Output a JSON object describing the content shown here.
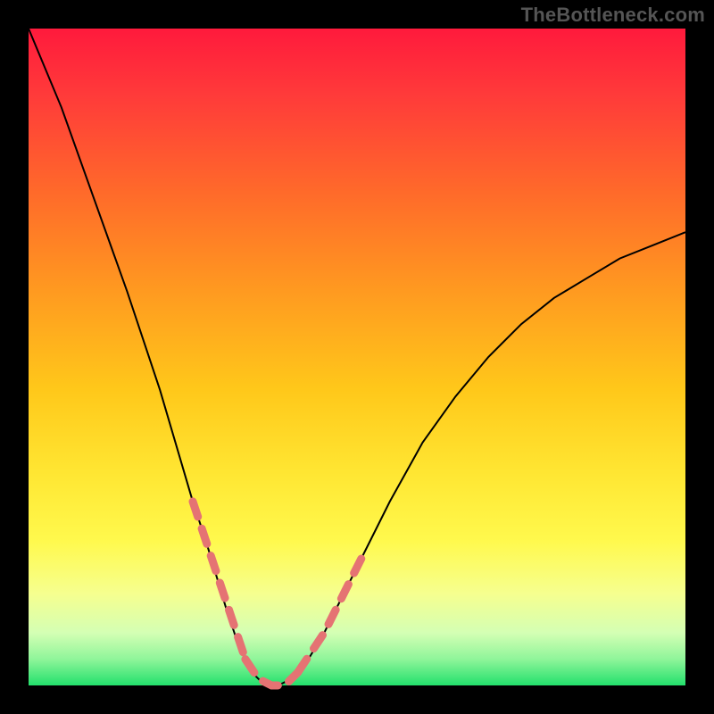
{
  "watermark": "TheBottleneck.com",
  "chart_data": {
    "type": "line",
    "title": "",
    "xlabel": "",
    "ylabel": "",
    "xlim": [
      0,
      100
    ],
    "ylim": [
      0,
      100
    ],
    "grid": false,
    "legend": false,
    "series": [
      {
        "name": "bottleneck-curve",
        "x": [
          0,
          5,
          10,
          15,
          20,
          25,
          27,
          30,
          32,
          34,
          36,
          38,
          40,
          42,
          45,
          50,
          55,
          60,
          65,
          70,
          75,
          80,
          85,
          90,
          95,
          100
        ],
        "y": [
          100,
          88,
          74,
          60,
          45,
          28,
          22,
          12,
          6,
          2,
          0,
          0,
          1,
          3,
          8,
          18,
          28,
          37,
          44,
          50,
          55,
          59,
          62,
          65,
          67,
          69
        ]
      }
    ],
    "highlight_segments": [
      {
        "name": "left-descent-dashes",
        "x": [
          25,
          27,
          29,
          31,
          33
        ],
        "y": [
          28,
          22,
          16,
          10,
          4
        ]
      },
      {
        "name": "trough-dashes",
        "x": [
          33,
          35,
          37,
          39,
          41
        ],
        "y": [
          4,
          1,
          0,
          0,
          2
        ]
      },
      {
        "name": "right-ascent-dashes",
        "x": [
          41,
          43,
          45,
          47,
          49,
          51
        ],
        "y": [
          2,
          5,
          8,
          12,
          16,
          20
        ]
      }
    ],
    "background_gradient": {
      "top_color": "#ff1a3c",
      "bottom_color": "#23e06c",
      "stops": [
        "red",
        "orange",
        "yellow",
        "green"
      ]
    },
    "colors": {
      "curve": "#000000",
      "dashes": "#e57373",
      "page_bg": "#000000"
    }
  }
}
